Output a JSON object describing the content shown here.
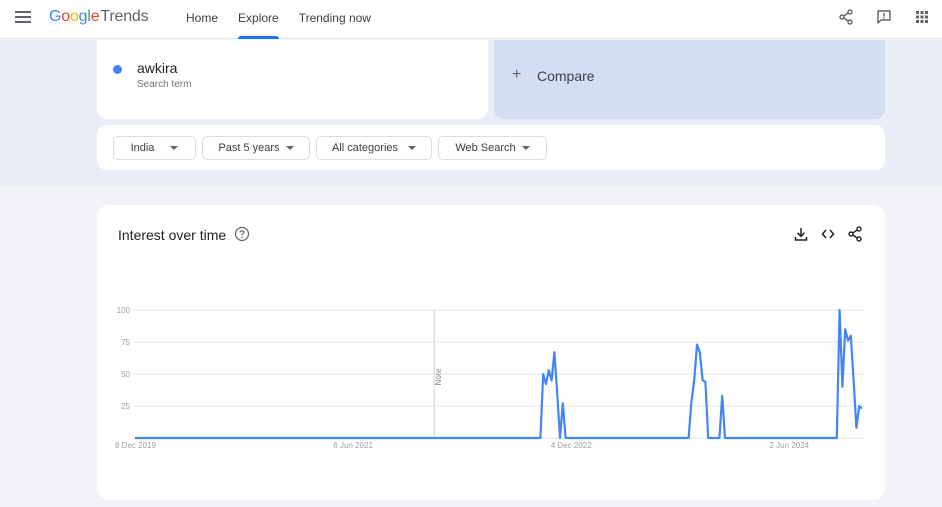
{
  "header": {
    "logo_letters": [
      "G",
      "o",
      "o",
      "g",
      "l",
      "e"
    ],
    "logo_product": "Trends",
    "nav": [
      {
        "label": "Home",
        "active": false
      },
      {
        "label": "Explore",
        "active": true
      },
      {
        "label": "Trending now",
        "active": false
      }
    ],
    "icons": [
      "share-icon",
      "feedback-icon",
      "apps-icon"
    ]
  },
  "search": {
    "term": "awkira",
    "term_sub": "Search term",
    "term_color": "#4285f4",
    "compare_label": "Compare"
  },
  "filters": [
    {
      "label": "India"
    },
    {
      "label": "Past 5 years"
    },
    {
      "label": "All categories"
    },
    {
      "label": "Web Search"
    }
  ],
  "panel": {
    "title": "Interest over time",
    "actions": [
      "download-icon",
      "embed-icon",
      "share-icon"
    ]
  },
  "chart_data": {
    "type": "line",
    "title": "Interest over time",
    "xlabel": "",
    "ylabel": "",
    "ylim": [
      0,
      100
    ],
    "yticks": [
      25,
      50,
      75,
      100
    ],
    "xticks": [
      {
        "week": 0,
        "label": "8 Dec 2019"
      },
      {
        "week": 78,
        "label": "6 Jun 2021"
      },
      {
        "week": 156,
        "label": "4 Dec 2022"
      },
      {
        "week": 234,
        "label": "2 Jun 2024"
      }
    ],
    "x_range_weeks": [
      0,
      260
    ],
    "note": {
      "week": 107,
      "label": "Note"
    },
    "grid": true,
    "legend": "none",
    "series": [
      {
        "name": "awkira",
        "color": "#4285f4",
        "points": [
          [
            0,
            0
          ],
          [
            145,
            0
          ],
          [
            146,
            50
          ],
          [
            147,
            42
          ],
          [
            148,
            53
          ],
          [
            149,
            45
          ],
          [
            150,
            67
          ],
          [
            151,
            35
          ],
          [
            152,
            0
          ],
          [
            153,
            27
          ],
          [
            154,
            0
          ],
          [
            198,
            0
          ],
          [
            199,
            28
          ],
          [
            200,
            45
          ],
          [
            201,
            73
          ],
          [
            202,
            67
          ],
          [
            203,
            45
          ],
          [
            204,
            44
          ],
          [
            205,
            0
          ],
          [
            209,
            0
          ],
          [
            210,
            33
          ],
          [
            211,
            0
          ],
          [
            251,
            0
          ],
          [
            252,
            100
          ],
          [
            253,
            40
          ],
          [
            254,
            85
          ],
          [
            255,
            76
          ],
          [
            256,
            80
          ],
          [
            257,
            45
          ],
          [
            258,
            8
          ],
          [
            259,
            25
          ],
          [
            260,
            23
          ]
        ]
      }
    ]
  }
}
